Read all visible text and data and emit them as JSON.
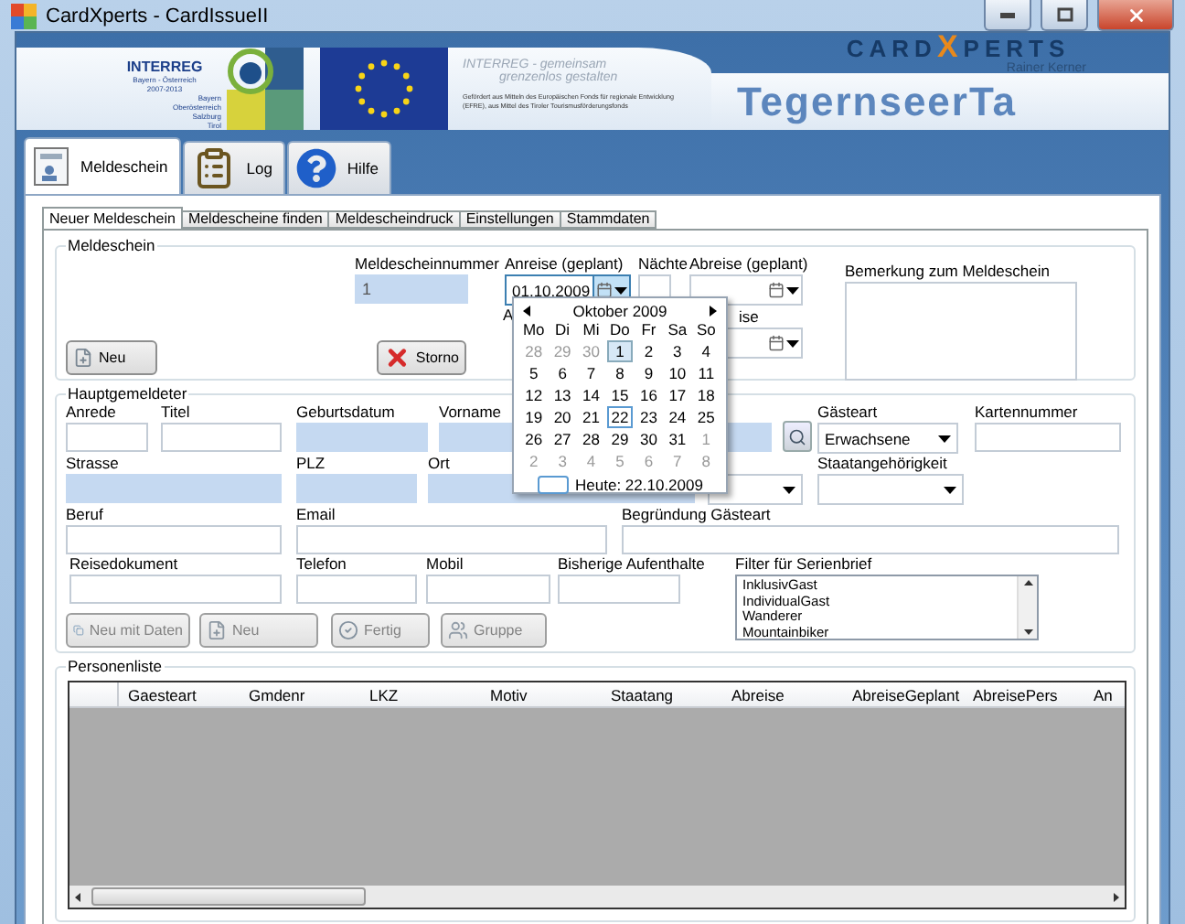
{
  "window": {
    "title": "CardXperts - CardIssueII"
  },
  "header": {
    "interreg": {
      "name": "INTERREG",
      "region": "Bayern - Österreich",
      "period": "2007-2013",
      "states": [
        "Bayern",
        "Oberösterreich",
        "Salzburg",
        "Tirol"
      ]
    },
    "slogan": [
      "INTERREG - gemeinsam",
      "grenzenlos gestalten"
    ],
    "funding": "Gefördert aus Mitteln des Europäischen Fonds für regionale Entwicklung (EFRE), aus Mittel des Tiroler Tourismusförderungsfonds",
    "brand": {
      "before": "CARD",
      "accent": "X",
      "after": "PERTS",
      "subtitle": "Rainer Kerner"
    },
    "banner_text": "TegernseerTa"
  },
  "main_tabs": [
    {
      "label": "Meldeschein",
      "selected": true
    },
    {
      "label": "Log",
      "selected": false
    },
    {
      "label": "Hilfe",
      "selected": false
    }
  ],
  "sub_tabs": [
    {
      "label": "Neuer Meldeschein",
      "selected": true
    },
    {
      "label": "Meldescheine finden",
      "selected": false
    },
    {
      "label": "Meldescheindruck",
      "selected": false
    },
    {
      "label": "Einstellungen",
      "selected": false
    },
    {
      "label": "Stammdaten",
      "selected": false
    }
  ],
  "meldeschein": {
    "title": "Meldeschein",
    "nummer": {
      "label": "Meldescheinnummer",
      "value": "1",
      "required": true
    },
    "anreise": {
      "label": "Anreise (geplant)",
      "value": "01.10.2009",
      "open": true
    },
    "hidden_label": "A",
    "naechte": {
      "label": "Nächte"
    },
    "abreise": {
      "label": "Abreise (geplant)"
    },
    "abreise_pers": {
      "label": "ise"
    },
    "bemerkung": {
      "label": "Bemerkung zum Meldeschein"
    },
    "buttons": [
      {
        "label": "Neu"
      },
      {
        "label": "Storno"
      }
    ]
  },
  "calendar": {
    "month": "Oktober 2009",
    "weekdays": [
      "Mo",
      "Di",
      "Mi",
      "Do",
      "Fr",
      "Sa",
      "So"
    ],
    "weeks": [
      [
        {
          "day": "28",
          "outside": true,
          "selected": false,
          "today": false
        },
        {
          "day": "29",
          "outside": true,
          "selected": false,
          "today": false
        },
        {
          "day": "30",
          "outside": true,
          "selected": false,
          "today": false
        },
        {
          "day": "1",
          "outside": false,
          "selected": true,
          "today": false
        },
        {
          "day": "2",
          "outside": false,
          "selected": false,
          "today": false
        },
        {
          "day": "3",
          "outside": false,
          "selected": false,
          "today": false
        },
        {
          "day": "4",
          "outside": false,
          "selected": false,
          "today": false
        }
      ],
      [
        {
          "day": "5",
          "outside": false,
          "selected": false,
          "today": false
        },
        {
          "day": "6",
          "outside": false,
          "selected": false,
          "today": false
        },
        {
          "day": "7",
          "outside": false,
          "selected": false,
          "today": false
        },
        {
          "day": "8",
          "outside": false,
          "selected": false,
          "today": false
        },
        {
          "day": "9",
          "outside": false,
          "selected": false,
          "today": false
        },
        {
          "day": "10",
          "outside": false,
          "selected": false,
          "today": false
        },
        {
          "day": "11",
          "outside": false,
          "selected": false,
          "today": false
        }
      ],
      [
        {
          "day": "12",
          "outside": false,
          "selected": false,
          "today": false
        },
        {
          "day": "13",
          "outside": false,
          "selected": false,
          "today": false
        },
        {
          "day": "14",
          "outside": false,
          "selected": false,
          "today": false
        },
        {
          "day": "15",
          "outside": false,
          "selected": false,
          "today": false
        },
        {
          "day": "16",
          "outside": false,
          "selected": false,
          "today": false
        },
        {
          "day": "17",
          "outside": false,
          "selected": false,
          "today": false
        },
        {
          "day": "18",
          "outside": false,
          "selected": false,
          "today": false
        }
      ],
      [
        {
          "day": "19",
          "outside": false,
          "selected": false,
          "today": false
        },
        {
          "day": "20",
          "outside": false,
          "selected": false,
          "today": false
        },
        {
          "day": "21",
          "outside": false,
          "selected": false,
          "today": false
        },
        {
          "day": "22",
          "outside": false,
          "selected": false,
          "today": true
        },
        {
          "day": "23",
          "outside": false,
          "selected": false,
          "today": false
        },
        {
          "day": "24",
          "outside": false,
          "selected": false,
          "today": false
        },
        {
          "day": "25",
          "outside": false,
          "selected": false,
          "today": false
        }
      ],
      [
        {
          "day": "26",
          "outside": false,
          "selected": false,
          "today": false
        },
        {
          "day": "27",
          "outside": false,
          "selected": false,
          "today": false
        },
        {
          "day": "28",
          "outside": false,
          "selected": false,
          "today": false
        },
        {
          "day": "29",
          "outside": false,
          "selected": false,
          "today": false
        },
        {
          "day": "30",
          "outside": false,
          "selected": false,
          "today": false
        },
        {
          "day": "31",
          "outside": false,
          "selected": false,
          "today": false
        },
        {
          "day": "1",
          "outside": true,
          "selected": false,
          "today": false
        }
      ],
      [
        {
          "day": "2",
          "outside": true,
          "selected": false,
          "today": false
        },
        {
          "day": "3",
          "outside": true,
          "selected": false,
          "today": false
        },
        {
          "day": "4",
          "outside": true,
          "selected": false,
          "today": false
        },
        {
          "day": "5",
          "outside": true,
          "selected": false,
          "today": false
        },
        {
          "day": "6",
          "outside": true,
          "selected": false,
          "today": false
        },
        {
          "day": "7",
          "outside": true,
          "selected": false,
          "today": false
        },
        {
          "day": "8",
          "outside": true,
          "selected": false,
          "today": false
        }
      ]
    ],
    "today": "Heute: 22.10.2009"
  },
  "hauptgemeldeter": {
    "title": "Hauptgemeldeter",
    "rows": [
      {
        "fields": [
          {
            "kind": "text",
            "label": "Anrede",
            "required": false
          },
          {
            "kind": "text",
            "label": "Titel",
            "required": false
          },
          {
            "kind": "text",
            "label": "Geburtsdatum",
            "required": true
          },
          {
            "kind": "text",
            "label": "Vorname",
            "required": true
          },
          {
            "kind": "search"
          },
          {
            "kind": "combo",
            "label": "Gästeart",
            "value": "Erwachsene"
          },
          {
            "kind": "text",
            "label": "Kartennummer",
            "required": false
          }
        ]
      },
      {
        "fields": [
          {
            "kind": "text",
            "label": "Strasse",
            "required": true
          },
          {
            "kind": "text",
            "label": "PLZ",
            "required": true
          },
          {
            "kind": "text",
            "label": "Ort",
            "required": true
          },
          {
            "kind": "combo"
          },
          {
            "kind": "combo",
            "label": "Staatangehörigkeit"
          }
        ]
      },
      {
        "fields": [
          {
            "kind": "text",
            "label": "Beruf",
            "required": false
          },
          {
            "kind": "text",
            "label": "Email",
            "required": false
          },
          {
            "kind": "text",
            "label": "Begründung Gästeart",
            "required": false
          }
        ]
      },
      {
        "fields": [
          {
            "kind": "text",
            "label": "Reisedokument",
            "required": false
          },
          {
            "kind": "text",
            "label": "Telefon",
            "required": false
          },
          {
            "kind": "text",
            "label": "Mobil",
            "required": false
          },
          {
            "kind": "text",
            "label": "Bisherige Aufenthalte",
            "required": false
          }
        ]
      }
    ],
    "filter": {
      "label": "Filter für Serienbrief",
      "items": [
        "InklusivGast",
        "IndividualGast",
        "Wanderer",
        "Mountainbiker"
      ]
    },
    "buttons": [
      {
        "label": "Neu mit Daten",
        "disabled": true
      },
      {
        "label": "Neu",
        "disabled": true
      },
      {
        "label": "Fertig",
        "disabled": true
      },
      {
        "label": "Gruppe",
        "disabled": true
      }
    ]
  },
  "personenliste": {
    "title": "Personenliste",
    "columns": [
      "Gaesteart",
      "Gmdenr",
      "LKZ",
      "Motiv",
      "Staatang",
      "Abreise",
      "AbreiseGeplant",
      "AbreisePers",
      "An"
    ]
  }
}
